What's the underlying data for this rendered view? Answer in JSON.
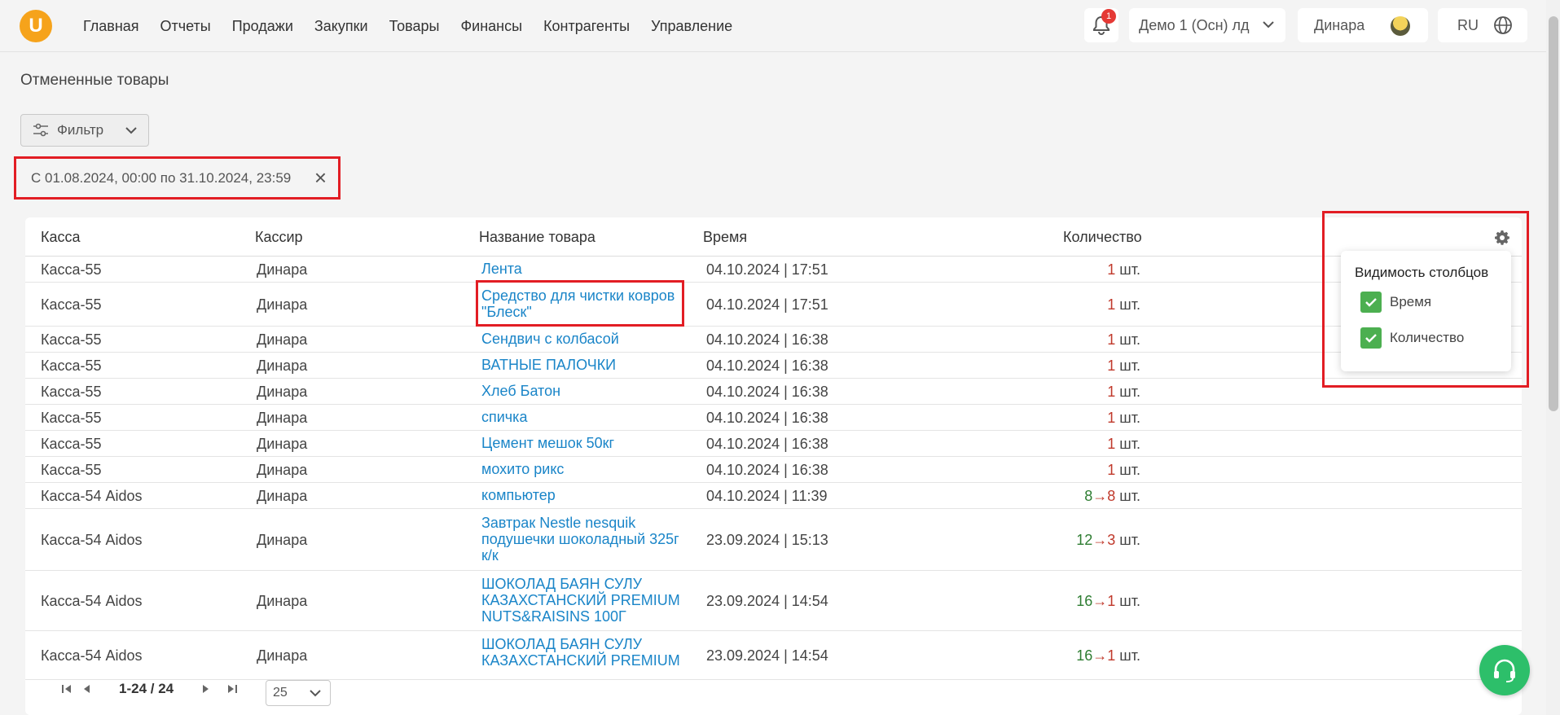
{
  "header": {
    "logo": "U",
    "nav": [
      "Главная",
      "Отчеты",
      "Продажи",
      "Закупки",
      "Товары",
      "Финансы",
      "Контрагенты",
      "Управление"
    ],
    "notifications_count": "1",
    "store": "Демо 1 (Осн) лд",
    "user": "Динара",
    "language": "RU"
  },
  "page": {
    "title": "Отмененные товары",
    "filter_label": "Фильтр",
    "date_range": "С 01.08.2024, 00:00 по 31.10.2024, 23:59"
  },
  "table": {
    "columns": [
      "Касса",
      "Кассир",
      "Название товара",
      "Время",
      "Количество"
    ],
    "unit": "шт.",
    "rows": [
      {
        "kassa": "Касса-55",
        "cashier": "Динара",
        "name": "Лента",
        "time": "04.10.2024 | 17:51",
        "from": "",
        "to": "1"
      },
      {
        "kassa": "Касса-55",
        "cashier": "Динара",
        "name": "Средство для чистки ковров \"Блеск\"",
        "time": "04.10.2024 | 17:51",
        "from": "",
        "to": "1"
      },
      {
        "kassa": "Касса-55",
        "cashier": "Динара",
        "name": "Сендвич с колбасой",
        "time": "04.10.2024 | 16:38",
        "from": "",
        "to": "1"
      },
      {
        "kassa": "Касса-55",
        "cashier": "Динара",
        "name": "ВАТНЫЕ ПАЛОЧКИ",
        "time": "04.10.2024 | 16:38",
        "from": "",
        "to": "1"
      },
      {
        "kassa": "Касса-55",
        "cashier": "Динара",
        "name": "Хлеб Батон",
        "time": "04.10.2024 | 16:38",
        "from": "",
        "to": "1"
      },
      {
        "kassa": "Касса-55",
        "cashier": "Динара",
        "name": "спичка",
        "time": "04.10.2024 | 16:38",
        "from": "",
        "to": "1"
      },
      {
        "kassa": "Касса-55",
        "cashier": "Динара",
        "name": "Цемент мешок 50кг",
        "time": "04.10.2024 | 16:38",
        "from": "",
        "to": "1"
      },
      {
        "kassa": "Касса-55",
        "cashier": "Динара",
        "name": "мохито рикс",
        "time": "04.10.2024 | 16:38",
        "from": "",
        "to": "1"
      },
      {
        "kassa": "Касса-54 Aidos",
        "cashier": "Динара",
        "name": "компьютер",
        "time": "04.10.2024 | 11:39",
        "from": "8",
        "to": "8"
      },
      {
        "kassa": "Касса-54 Aidos",
        "cashier": "Динара",
        "name": "Завтрак Nestle nesquik подушечки шоколадный 325г к/к",
        "time": "23.09.2024 | 15:13",
        "from": "12",
        "to": "3"
      },
      {
        "kassa": "Касса-54 Aidos",
        "cashier": "Динара",
        "name": "ШОКОЛАД БАЯН СУЛУ КАЗАХСТАНСКИЙ PREMIUM NUTS&RAISINS 100Г",
        "time": "23.09.2024 | 14:54",
        "from": "16",
        "to": "1"
      },
      {
        "kassa": "Касса-54 Aidos",
        "cashier": "Динара",
        "name": "ШОКОЛАД БАЯН СУЛУ КАЗАХСТАНСКИЙ PREMIUM",
        "time": "23.09.2024 | 14:54",
        "from": "16",
        "to": "1"
      }
    ]
  },
  "column_visibility": {
    "title": "Видимость столбцов",
    "options": [
      {
        "label": "Время",
        "checked": true
      },
      {
        "label": "Количество",
        "checked": true
      }
    ]
  },
  "pagination": {
    "range": "1-24 / 24",
    "page_size": "25"
  }
}
